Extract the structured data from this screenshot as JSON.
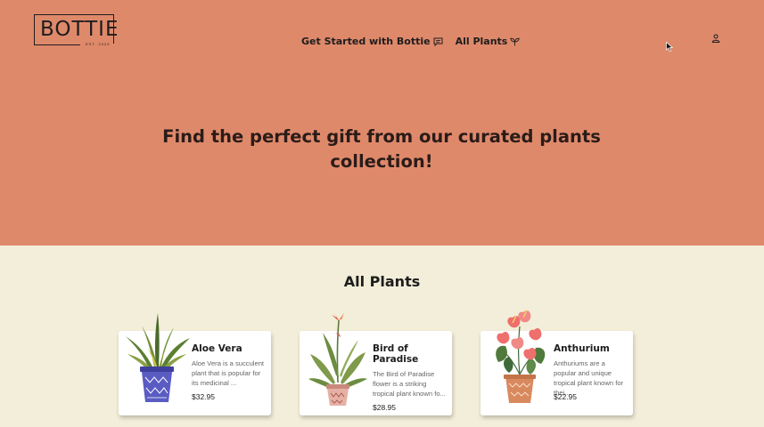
{
  "brand": {
    "name": "BOTTIE",
    "tagline": "EST. 2020"
  },
  "nav": [
    {
      "label": "Get Started with Bottie",
      "icon": "chat-icon"
    },
    {
      "label": "All Plants",
      "icon": "sprout-icon"
    }
  ],
  "hero": {
    "headline": "Find the perfect gift from our curated plants collection!"
  },
  "catalog": {
    "title": "All Plants",
    "products": [
      {
        "name": "Aloe Vera",
        "description": "Aloe Vera is a succulent plant that is popular for its medicinal ...",
        "price": "$32.95"
      },
      {
        "name": "Bird of Paradise",
        "description": "The Bird of Paradise flower is a striking tropical plant known fo...",
        "price": "$28.95"
      },
      {
        "name": "Anthurium",
        "description": "Anthuriums are a popular and unique tropical plant known for thei...",
        "price": "$22.95"
      }
    ]
  },
  "colors": {
    "hero": "#df886b",
    "page": "#f3eed9",
    "card": "#ffffff",
    "text": "#1d1d1d"
  }
}
